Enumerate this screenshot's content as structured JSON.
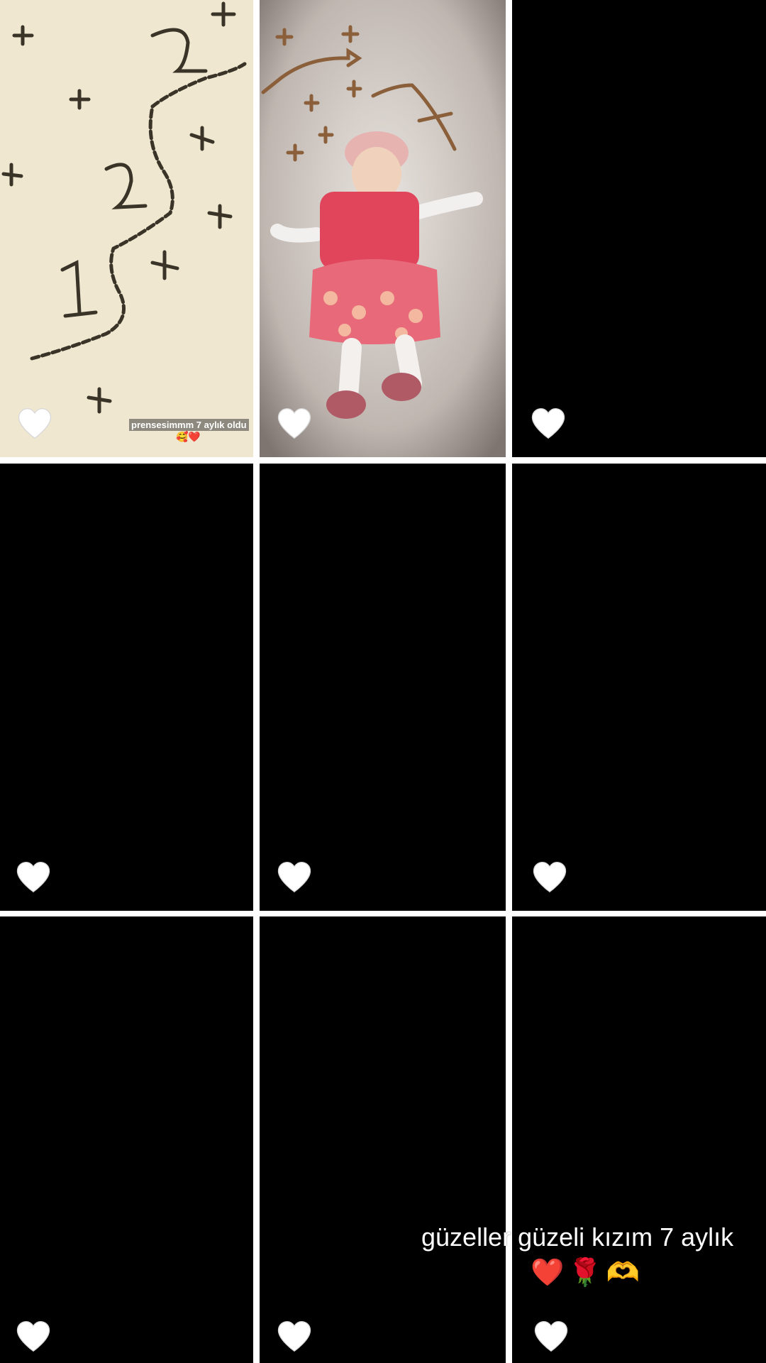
{
  "grid": {
    "cells": [
      {
        "id": "cell-1",
        "type": "photo-seeds",
        "caption": "prensesimmm 7 aylık oldu",
        "caption_emoji": "🥰❤️"
      },
      {
        "id": "cell-2",
        "type": "photo-baby"
      },
      {
        "id": "cell-3",
        "type": "empty"
      },
      {
        "id": "cell-4",
        "type": "empty"
      },
      {
        "id": "cell-5",
        "type": "empty"
      },
      {
        "id": "cell-6",
        "type": "empty"
      },
      {
        "id": "cell-7",
        "type": "empty"
      },
      {
        "id": "cell-8",
        "type": "empty"
      },
      {
        "id": "cell-9",
        "type": "empty"
      }
    ],
    "heart_icon": "white-heart-icon"
  },
  "overlay": {
    "text": "güzeller güzeli kızım 7 aylık",
    "emojis": [
      "❤️",
      "🌹",
      "🫶"
    ]
  },
  "colors": {
    "divider": "#ffffff",
    "cell_background": "#000000",
    "heart": "#ffffff"
  }
}
